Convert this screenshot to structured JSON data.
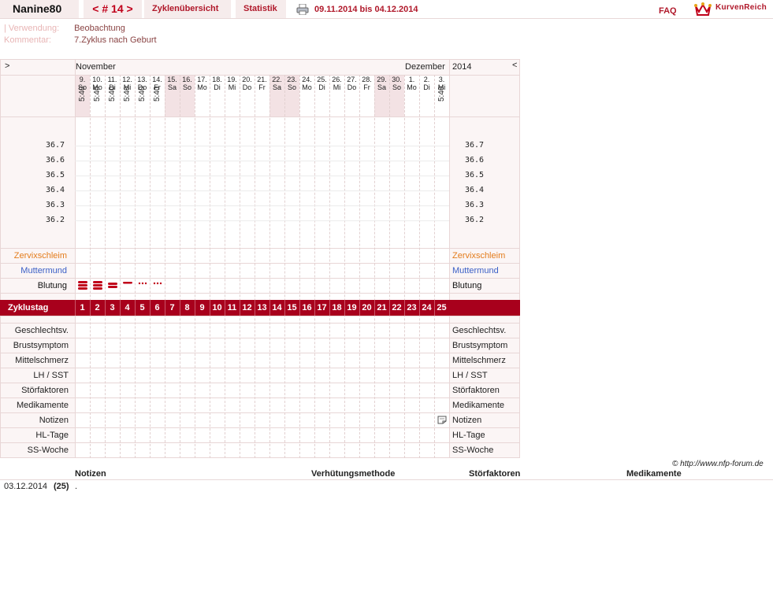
{
  "header": {
    "user": "Nanine80",
    "cycle_prev": "<",
    "cycle_label": "# 14",
    "cycle_next": ">",
    "tab_overview": "Zyklenübersicht",
    "tab_stats": "Statistik",
    "date_range": "09.11.2014 bis 04.12.2014",
    "faq": "FAQ",
    "logo": "KurvenReich"
  },
  "info": {
    "usage_label": "Verwendung:",
    "usage_value": "Beobachtung",
    "comment_label": "Kommentar:",
    "comment_value": "7.Zyklus nach Geburt"
  },
  "chart": {
    "nav_left": ">",
    "nav_right": "<",
    "month1": "November",
    "month2": "Dezember",
    "year": "2014",
    "days": [
      {
        "d": "9.",
        "w": "So",
        "time": "5:40",
        "weekend": true
      },
      {
        "d": "10.",
        "w": "Mo",
        "time": "5:40",
        "weekend": false
      },
      {
        "d": "11.",
        "w": "Di",
        "time": "5:40",
        "weekend": false
      },
      {
        "d": "12.",
        "w": "Mi",
        "time": "5:40",
        "weekend": false
      },
      {
        "d": "13.",
        "w": "Do",
        "time": "5:40",
        "weekend": false
      },
      {
        "d": "14.",
        "w": "Fr",
        "time": "5:40",
        "weekend": false
      },
      {
        "d": "15.",
        "w": "Sa",
        "time": "",
        "weekend": true
      },
      {
        "d": "16.",
        "w": "So",
        "time": "",
        "weekend": true
      },
      {
        "d": "17.",
        "w": "Mo",
        "time": "",
        "weekend": false
      },
      {
        "d": "18.",
        "w": "Di",
        "time": "",
        "weekend": false
      },
      {
        "d": "19.",
        "w": "Mi",
        "time": "",
        "weekend": false
      },
      {
        "d": "20.",
        "w": "Do",
        "time": "",
        "weekend": false
      },
      {
        "d": "21.",
        "w": "Fr",
        "time": "",
        "weekend": false
      },
      {
        "d": "22.",
        "w": "Sa",
        "time": "",
        "weekend": true
      },
      {
        "d": "23.",
        "w": "So",
        "time": "",
        "weekend": true
      },
      {
        "d": "24.",
        "w": "Mo",
        "time": "",
        "weekend": false
      },
      {
        "d": "25.",
        "w": "Di",
        "time": "",
        "weekend": false
      },
      {
        "d": "26.",
        "w": "Mi",
        "time": "",
        "weekend": false
      },
      {
        "d": "27.",
        "w": "Do",
        "time": "",
        "weekend": false
      },
      {
        "d": "28.",
        "w": "Fr",
        "time": "",
        "weekend": false
      },
      {
        "d": "29.",
        "w": "Sa",
        "time": "",
        "weekend": true
      },
      {
        "d": "30.",
        "w": "So",
        "time": "",
        "weekend": true
      },
      {
        "d": "1.",
        "w": "Mo",
        "time": "",
        "weekend": false
      },
      {
        "d": "2.",
        "w": "Di",
        "time": "",
        "weekend": false
      },
      {
        "d": "3.",
        "w": "Mi",
        "time": "5:40",
        "weekend": false
      }
    ],
    "temps": [
      "36.7",
      "36.6",
      "36.5",
      "36.4",
      "36.3",
      "36.2"
    ],
    "row_labels": {
      "cervix": "Zervixschleim",
      "cervix_color": "#e37c1c",
      "os": "Muttermund",
      "os_color": "#3a5fc6",
      "bleeding": "Blutung"
    },
    "bleeding": [
      "heavy",
      "heavy",
      "medium",
      "light",
      "spotting",
      "spotting"
    ],
    "cycle_day_label": "Zyklustag",
    "cycle_days": [
      "1",
      "2",
      "3",
      "4",
      "5",
      "6",
      "7",
      "8",
      "9",
      "10",
      "11",
      "12",
      "13",
      "14",
      "15",
      "16",
      "17",
      "18",
      "19",
      "20",
      "21",
      "22",
      "23",
      "24",
      "25"
    ],
    "cycle_color": "#a8001c",
    "extra_rows": [
      "Geschlechtsv.",
      "Brustsymptom",
      "Mittelschmerz",
      "LH / SST",
      "Störfaktoren",
      "Medikamente",
      "Notizen",
      "HL-Tage",
      "SS-Woche"
    ],
    "note_icon_day": 25
  },
  "footer": {
    "copyright": "© http://www.nfp-forum.de"
  },
  "notes_table": {
    "col_notes": "Notizen",
    "col_method": "Verhütungsmethode",
    "col_disturb": "Störfaktoren",
    "col_meds": "Medikamente",
    "rows": [
      {
        "date": "03.12.2014",
        "day": "(25)",
        "note": "."
      }
    ]
  }
}
